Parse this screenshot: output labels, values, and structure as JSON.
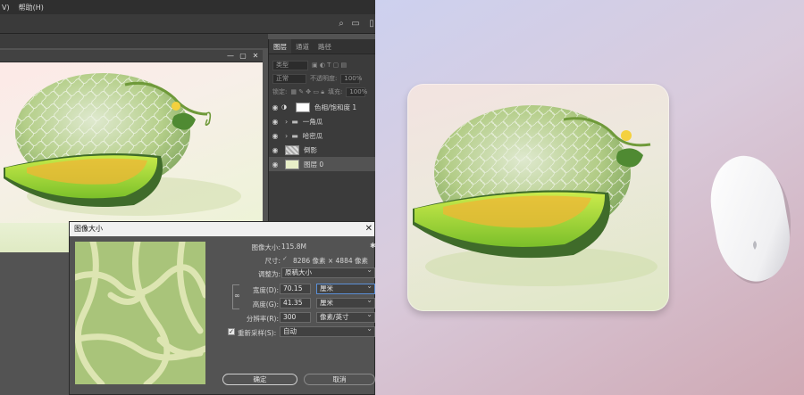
{
  "app": {
    "menu": [
      "V)",
      "帮助(H)"
    ]
  },
  "layers_panel": {
    "tabs": [
      "图层",
      "通道",
      "路径"
    ],
    "kind_placeholder": "类型",
    "blend_mode": "正常",
    "opacity_label": "不透明度:",
    "opacity_value": "100%",
    "lock_label": "锁定:",
    "fill_label": "填充:",
    "fill_value": "100%",
    "layers": [
      {
        "name": "色相/饱和度 1",
        "selected": false
      },
      {
        "name": "一角瓜",
        "selected": false
      },
      {
        "name": "哈密瓜",
        "selected": false
      },
      {
        "name": "倒影",
        "selected": false
      },
      {
        "name": "图层 0",
        "selected": true
      }
    ]
  },
  "image_size_dialog": {
    "title": "图像大小",
    "image_size_label": "图像大小:",
    "image_size_value": "115.8M",
    "dimensions_label": "尺寸:",
    "dimensions_value": "8286 像素 × 4884 像素",
    "fit_to_label": "调整为:",
    "fit_to_value": "原稿大小",
    "width_label": "宽度(D):",
    "width_value": "70.15",
    "width_unit": "厘米",
    "height_label": "高度(G):",
    "height_value": "41.35",
    "height_unit": "厘米",
    "resolution_label": "分辨率(R):",
    "resolution_value": "300",
    "resolution_unit": "像素/英寸",
    "resample_label": "重新采样(S):",
    "resample_value": "自动",
    "resample_checked": true,
    "ok_label": "确定",
    "cancel_label": "取消"
  },
  "colors": {
    "ps_bg": "#535353",
    "melon_green": "#b5cf8a",
    "flesh": "#a4d63a",
    "seeds": "#f0b634"
  }
}
